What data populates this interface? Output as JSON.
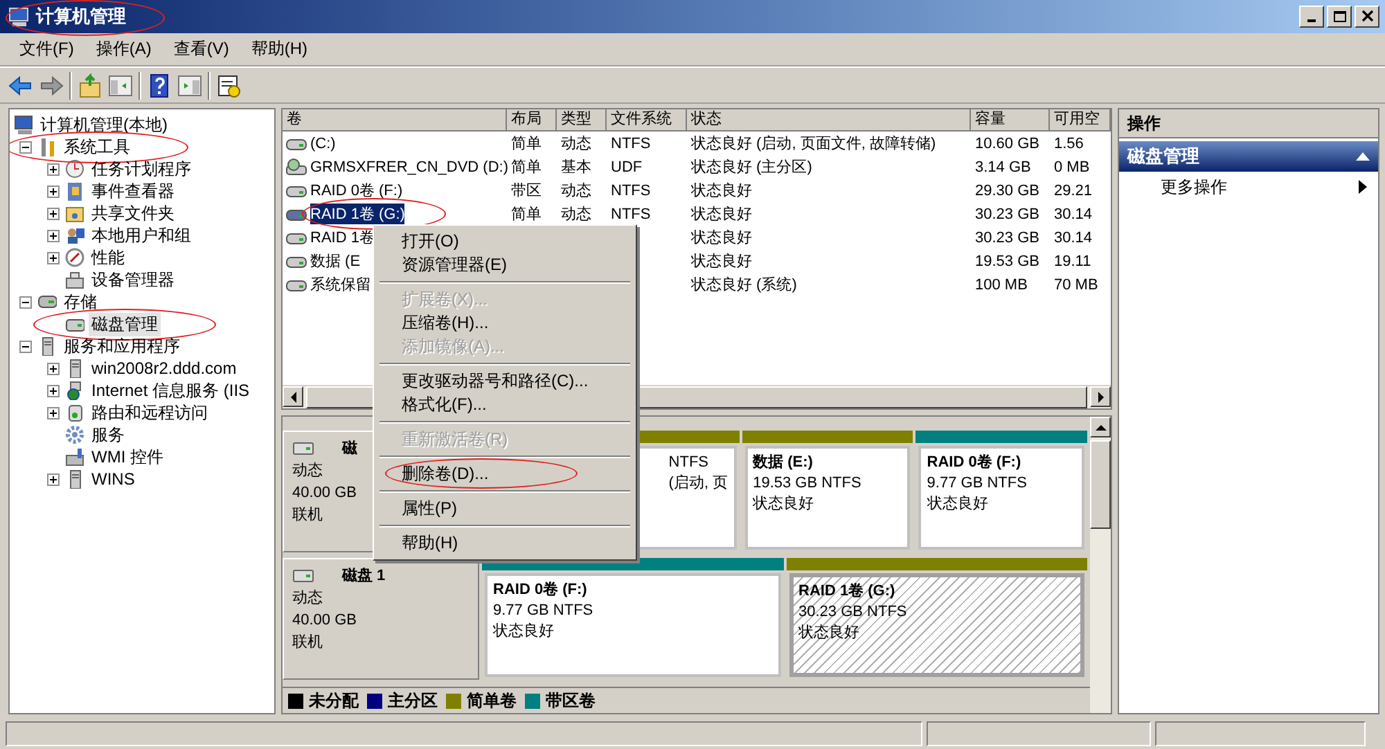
{
  "window": {
    "title": "计算机管理",
    "circled": true
  },
  "menu_bar": [
    {
      "label": "文件(F)"
    },
    {
      "label": "操作(A)"
    },
    {
      "label": "查看(V)"
    },
    {
      "label": "帮助(H)"
    }
  ],
  "tree": [
    {
      "label": "计算机管理(本地)",
      "kind": "root",
      "selected": false,
      "circled": false,
      "children": [
        {
          "label": "系统工具",
          "kind": "node",
          "expanded": true,
          "selected": false,
          "circled": true,
          "children": [
            {
              "label": "任务计划程序",
              "kind": "node",
              "expanded": false,
              "selected": false,
              "circled": false
            },
            {
              "label": "事件查看器",
              "kind": "node",
              "expanded": false,
              "selected": false,
              "circled": false
            },
            {
              "label": "共享文件夹",
              "kind": "node",
              "expanded": false,
              "selected": false,
              "circled": false
            },
            {
              "label": "本地用户和组",
              "kind": "node",
              "expanded": false,
              "selected": false,
              "circled": false
            },
            {
              "label": "性能",
              "kind": "node",
              "expanded": false,
              "selected": false,
              "circled": false
            },
            {
              "label": "设备管理器",
              "kind": "leaf",
              "selected": false,
              "circled": false
            }
          ]
        },
        {
          "label": "存储",
          "kind": "node",
          "expanded": true,
          "selected": false,
          "circled": false,
          "children": [
            {
              "label": "磁盘管理",
              "kind": "leaf",
              "selected": true,
              "circled": true
            }
          ]
        },
        {
          "label": "服务和应用程序",
          "kind": "node",
          "expanded": true,
          "selected": false,
          "circled": false,
          "children": [
            {
              "label": "win2008r2.ddd.com",
              "kind": "node",
              "expanded": false,
              "selected": false,
              "circled": false
            },
            {
              "label": "Internet 信息服务 (IIS",
              "kind": "node",
              "expanded": false,
              "selected": false,
              "circled": false
            },
            {
              "label": "路由和远程访问",
              "kind": "node",
              "expanded": false,
              "selected": false,
              "circled": false
            },
            {
              "label": "服务",
              "kind": "leaf",
              "selected": false,
              "circled": false
            },
            {
              "label": "WMI 控件",
              "kind": "leaf",
              "selected": false,
              "circled": false
            },
            {
              "label": "WINS",
              "kind": "node",
              "expanded": false,
              "selected": false,
              "circled": false
            }
          ]
        }
      ]
    }
  ],
  "volumes": {
    "columns": [
      "卷",
      "布局",
      "类型",
      "文件系统",
      "状态",
      "容量",
      "可用空"
    ],
    "rows": [
      {
        "volume": "(C:)",
        "layout": "简单",
        "type": "动态",
        "fs": "NTFS",
        "status": "状态良好 (启动, 页面文件, 故障转储)",
        "capacity": "10.60 GB",
        "free": "1.56",
        "selected": false,
        "circled": false
      },
      {
        "volume": "GRMSXFRER_CN_DVD (D:)",
        "layout": "简单",
        "type": "基本",
        "fs": "UDF",
        "status": "状态良好 (主分区)",
        "capacity": "3.14 GB",
        "free": "0 MB",
        "selected": false,
        "circled": false
      },
      {
        "volume": "RAID 0卷 (F:)",
        "layout": "带区",
        "type": "动态",
        "fs": "NTFS",
        "status": "状态良好",
        "capacity": "29.30 GB",
        "free": "29.21",
        "selected": false,
        "circled": false
      },
      {
        "volume": "RAID 1卷 (G:)",
        "layout": "简单",
        "type": "动态",
        "fs": "NTFS",
        "status": "状态良好",
        "capacity": "30.23 GB",
        "free": "30.14",
        "selected": true,
        "circled": true
      },
      {
        "volume": "RAID 1卷",
        "status": "状态良好",
        "capacity": "30.23 GB",
        "free": "30.14",
        "selected": false,
        "circled": false
      },
      {
        "volume": "数据 (E",
        "status": "状态良好",
        "capacity": "19.53 GB",
        "free": "19.11",
        "selected": false,
        "circled": false
      },
      {
        "volume": "系统保留",
        "status": "状态良好 (系统)",
        "capacity": "100 MB",
        "free": "70 MB",
        "selected": false,
        "circled": false
      }
    ]
  },
  "context_menu": {
    "items": [
      {
        "kind": "item",
        "label": "打开(O)",
        "disabled": false,
        "circled": false
      },
      {
        "kind": "item",
        "label": "资源管理器(E)",
        "disabled": false,
        "circled": false
      },
      {
        "kind": "separator"
      },
      {
        "kind": "item",
        "label": "扩展卷(X)...",
        "disabled": true,
        "circled": false
      },
      {
        "kind": "item",
        "label": "压缩卷(H)...",
        "disabled": false,
        "circled": false
      },
      {
        "kind": "item",
        "label": "添加镜像(A)...",
        "disabled": true,
        "circled": false
      },
      {
        "kind": "separator"
      },
      {
        "kind": "item",
        "label": "更改驱动器号和路径(C)...",
        "disabled": false,
        "circled": false
      },
      {
        "kind": "item",
        "label": "格式化(F)...",
        "disabled": false,
        "circled": false
      },
      {
        "kind": "separator"
      },
      {
        "kind": "item",
        "label": "重新激活卷(R)",
        "disabled": true,
        "circled": false
      },
      {
        "kind": "separator"
      },
      {
        "kind": "item",
        "label": "删除卷(D)...",
        "disabled": false,
        "circled": true
      },
      {
        "kind": "separator"
      },
      {
        "kind": "item",
        "label": "属性(P)",
        "disabled": false,
        "circled": false
      },
      {
        "kind": "separator"
      },
      {
        "kind": "item",
        "label": "帮助(H)",
        "disabled": false,
        "circled": false
      }
    ]
  },
  "disks": [
    {
      "name": "磁",
      "type": "动态",
      "size": "40.00 GB",
      "state": "联机",
      "partitions": [
        {
          "kind": "covered",
          "size": "NTFS",
          "status": "(启动, 页",
          "color": "#808000",
          "selected": false
        },
        {
          "kind": "volume",
          "name": "数据  (E:)",
          "size": "19.53 GB NTFS",
          "status": "状态良好",
          "color": "#808000",
          "selected": false
        },
        {
          "kind": "volume",
          "name": "RAID 0卷  (F:)",
          "size": "9.77 GB NTFS",
          "status": "状态良好",
          "color": "#008080",
          "selected": false
        }
      ]
    },
    {
      "name": "磁盘 1",
      "type": "动态",
      "size": "40.00 GB",
      "state": "联机",
      "partitions": [
        {
          "kind": "volume",
          "name": "RAID 0卷  (F:)",
          "size": "9.77 GB NTFS",
          "status": "状态良好",
          "color": "#008080",
          "selected": false
        },
        {
          "kind": "volume",
          "name": "RAID 1卷  (G:)",
          "size": "30.23 GB NTFS",
          "status": "状态良好",
          "color": "#808000",
          "selected": true
        }
      ]
    }
  ],
  "legend": [
    {
      "label": "未分配",
      "color": "#000000"
    },
    {
      "label": "主分区",
      "color": "#000080"
    },
    {
      "label": "简单卷",
      "color": "#808000"
    },
    {
      "label": "带区卷",
      "color": "#008080"
    }
  ],
  "actions": {
    "title": "操作",
    "section": {
      "label": "磁盘管理",
      "expanded": true
    },
    "items": [
      {
        "label": "更多操作"
      }
    ]
  }
}
